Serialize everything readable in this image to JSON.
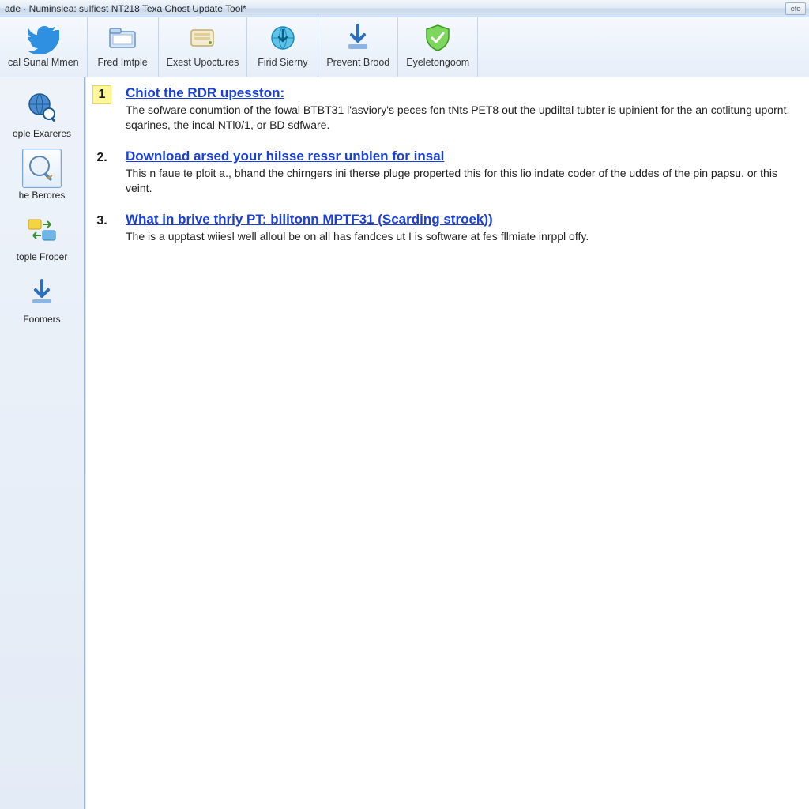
{
  "window": {
    "title": "ade · Numinslea: sulfiest NT218 Texa Chost Update Tool*",
    "button_hint": "efo"
  },
  "toolbar": {
    "items": [
      {
        "label": "cal Sunal Mmen",
        "icon": "bird-icon"
      },
      {
        "label": "Fred Imtple",
        "icon": "folder-icon"
      },
      {
        "label": "Exest Upoctures",
        "icon": "drive-icon"
      },
      {
        "label": "Firid Sierny",
        "icon": "globe-arrow-icon"
      },
      {
        "label": "Prevent Brood",
        "icon": "download-icon"
      },
      {
        "label": "Eyeletongoom",
        "icon": "shield-check-icon"
      }
    ]
  },
  "sidebar": {
    "items": [
      {
        "label": "ople Exareres",
        "icon": "globe-magnify-icon",
        "selected": false
      },
      {
        "label": "he Berores",
        "icon": "magnify-icon",
        "selected": true
      },
      {
        "label": "tople Froper",
        "icon": "transfer-icon",
        "selected": false
      },
      {
        "label": "Foomers",
        "icon": "download-small-icon",
        "selected": false
      }
    ]
  },
  "steps": [
    {
      "num": "1",
      "headline": "Chiot the RDR upesston:",
      "desc": "The sofware conumtion of the fowal BTBT31 l'asviory's peces fon tNts PET8 out the updiltal tubter is upinient for the an cotlitung upornt, sqarines, the incal NTl0/1, or BD sdfware."
    },
    {
      "num": "2.",
      "headline": "Download arsed your hilsse ressr unblen for insal",
      "desc": "This n faue te ploit a., bhand the chirngers ini therse pluge properted this for this lio indate coder of the uddes of the pin papsu. or this veint."
    },
    {
      "num": "3.",
      "headline": "What in brive thriy PT: bilitonn MPTF31 (Scarding stroek))",
      "desc": "The is a upptast wiiesl well alloul be on all has fandces ut I is software at fes fllmiate inrppl offy."
    }
  ]
}
